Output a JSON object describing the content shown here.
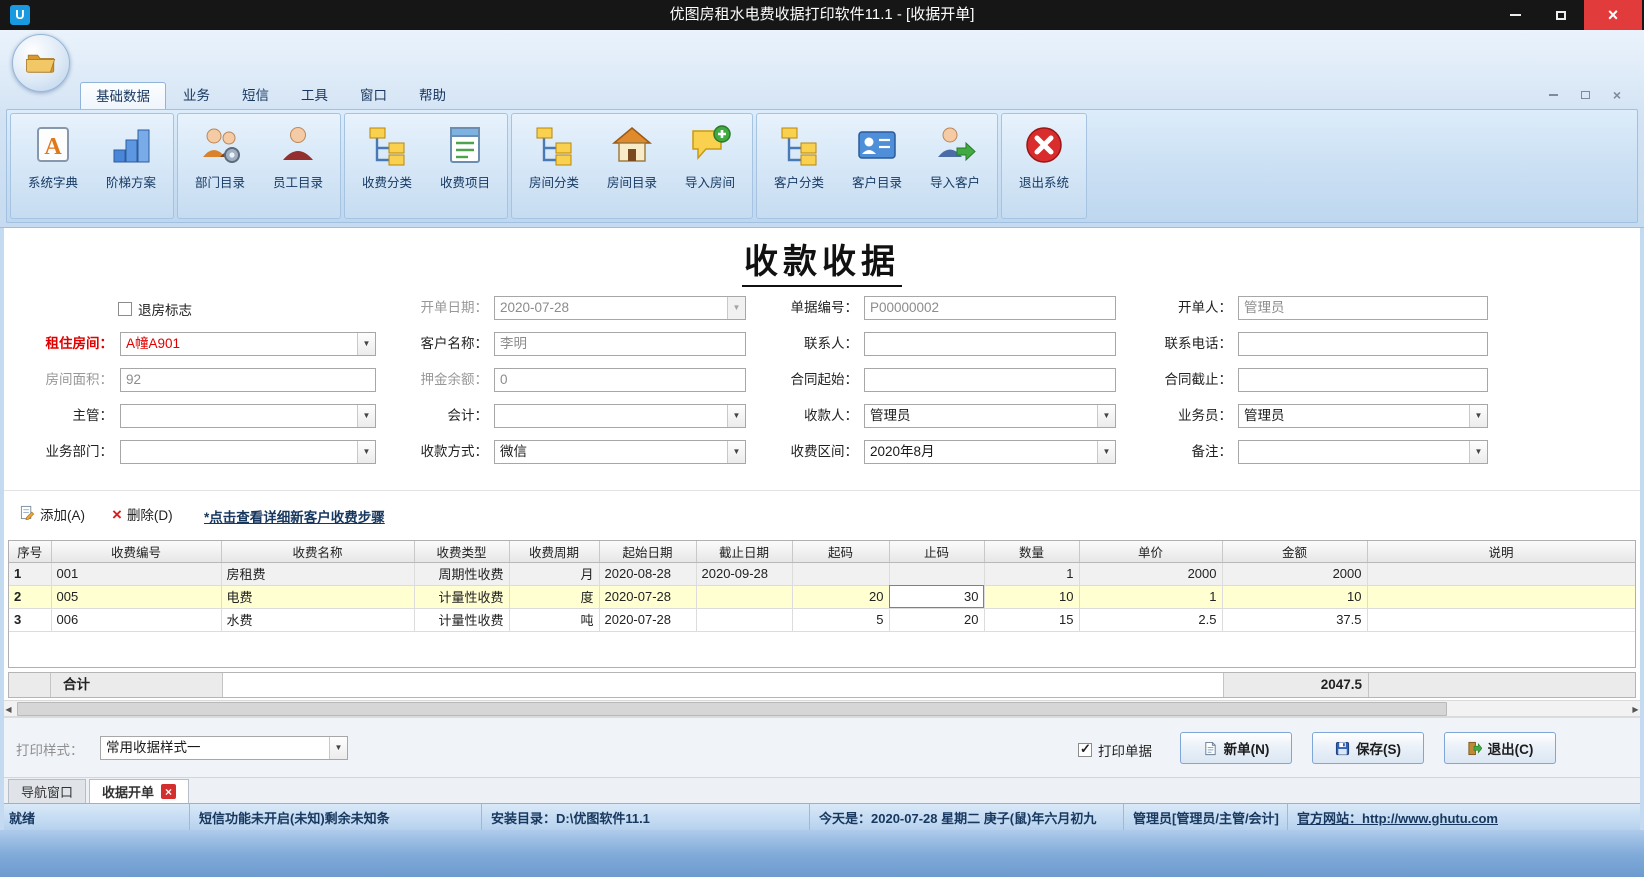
{
  "window": {
    "title": "优图房租水电费收据打印软件11.1 - [收据开单]",
    "app_badge": "U"
  },
  "ribbon": {
    "tabs": [
      {
        "label": "基础数据"
      },
      {
        "label": "业务"
      },
      {
        "label": "短信"
      },
      {
        "label": "工具"
      },
      {
        "label": "窗口"
      },
      {
        "label": "帮助"
      }
    ],
    "groups": [
      {
        "items": [
          {
            "label": "系统字典",
            "icon": "dictionary-icon"
          },
          {
            "label": "阶梯方案",
            "icon": "tier-plan-icon"
          }
        ]
      },
      {
        "items": [
          {
            "label": "部门目录",
            "icon": "department-directory-icon"
          },
          {
            "label": "员工目录",
            "icon": "employee-directory-icon"
          }
        ]
      },
      {
        "items": [
          {
            "label": "收费分类",
            "icon": "fee-category-icon"
          },
          {
            "label": "收费项目",
            "icon": "fee-item-icon"
          }
        ]
      },
      {
        "items": [
          {
            "label": "房间分类",
            "icon": "room-category-icon"
          },
          {
            "label": "房间目录",
            "icon": "room-directory-icon"
          },
          {
            "label": "导入房间",
            "icon": "import-room-icon"
          }
        ]
      },
      {
        "items": [
          {
            "label": "客户分类",
            "icon": "customer-category-icon"
          },
          {
            "label": "客户目录",
            "icon": "customer-directory-icon"
          },
          {
            "label": "导入客户",
            "icon": "import-customer-icon"
          }
        ]
      },
      {
        "items": [
          {
            "label": "退出系统",
            "icon": "exit-system-icon"
          }
        ]
      }
    ]
  },
  "form": {
    "title": "收款收据",
    "checkout_flag": "退房标志",
    "fields": {
      "bill_date": {
        "label": "开单日期：",
        "value": "2020-07-28"
      },
      "bill_no": {
        "label": "单据编号：",
        "value": "P00000002"
      },
      "biller": {
        "label": "开单人：",
        "value": "管理员"
      },
      "room": {
        "label": "租住房间：",
        "value": "A幢A901"
      },
      "customer": {
        "label": "客户名称：",
        "value": "李明"
      },
      "contact": {
        "label": "联系人：",
        "value": ""
      },
      "phone": {
        "label": "联系电话：",
        "value": ""
      },
      "room_area": {
        "label": "房间面积：",
        "value": "92"
      },
      "deposit": {
        "label": "押金余额：",
        "value": "0"
      },
      "contract_start": {
        "label": "合同起始：",
        "value": ""
      },
      "contract_end": {
        "label": "合同截止：",
        "value": ""
      },
      "supervisor": {
        "label": "主管：",
        "value": ""
      },
      "accountant": {
        "label": "会计：",
        "value": ""
      },
      "payee": {
        "label": "收款人：",
        "value": "管理员"
      },
      "salesman": {
        "label": "业务员：",
        "value": "管理员"
      },
      "department": {
        "label": "业务部门：",
        "value": ""
      },
      "pay_method": {
        "label": "收款方式：",
        "value": "微信"
      },
      "fee_range": {
        "label": "收费区间：",
        "value": "2020年8月"
      },
      "remark": {
        "label": "备注：",
        "value": ""
      }
    }
  },
  "detail_toolbar": {
    "add": "添加(A)",
    "delete": "删除(D)",
    "help_link": "*点击查看详细新客户收费步骤"
  },
  "grid": {
    "columns": [
      "序号",
      "收费编号",
      "收费名称",
      "收费类型",
      "收费周期",
      "起始日期",
      "截止日期",
      "起码",
      "止码",
      "数量",
      "单价",
      "金额",
      "说明"
    ],
    "rows": [
      [
        "1",
        "001",
        "房租费",
        "周期性收费",
        "月",
        "2020-08-28",
        "2020-09-28",
        "",
        "",
        "1",
        "2000",
        "2000",
        ""
      ],
      [
        "2",
        "005",
        "电费",
        "计量性收费",
        "度",
        "2020-07-28",
        "",
        "20",
        "30",
        "10",
        "1",
        "10",
        ""
      ],
      [
        "3",
        "006",
        "水费",
        "计量性收费",
        "吨",
        "2020-07-28",
        "",
        "5",
        "20",
        "15",
        "2.5",
        "37.5",
        ""
      ]
    ],
    "total_label": "合计",
    "total_value": "2047.5"
  },
  "footer_bar": {
    "print_style_label": "打印样式：",
    "print_style_value": "常用收据样式一",
    "print_receipt": "打印单据",
    "new_btn": "新单(N)",
    "save_btn": "保存(S)",
    "exit_btn": "退出(C)"
  },
  "doc_tabs": [
    {
      "label": "导航窗口"
    },
    {
      "label": "收据开单"
    }
  ],
  "status_bar": {
    "ready": "就绪",
    "sms": "短信功能未开启(未知)剩余未知条",
    "install_dir": "安装目录：D:\\优图软件11.1",
    "today": "今天是：2020-07-28 星期二 庚子(鼠)年六月初九",
    "user": "管理员[管理员/主管/会计]",
    "website": "官方网站：http://www.ghutu.com"
  },
  "icons": {
    "combo_arrow": "▼",
    "check": "✓",
    "window_close": "×",
    "delete_x": "×",
    "scroll_left": "◀",
    "scroll_right": "▶"
  },
  "colors": {
    "accent_red": "#e10000",
    "selected_row": "#ffffd2",
    "ribbon_blue": "#cfe2f4",
    "status_text": "#17375e",
    "close_button": "#e23b3b"
  }
}
